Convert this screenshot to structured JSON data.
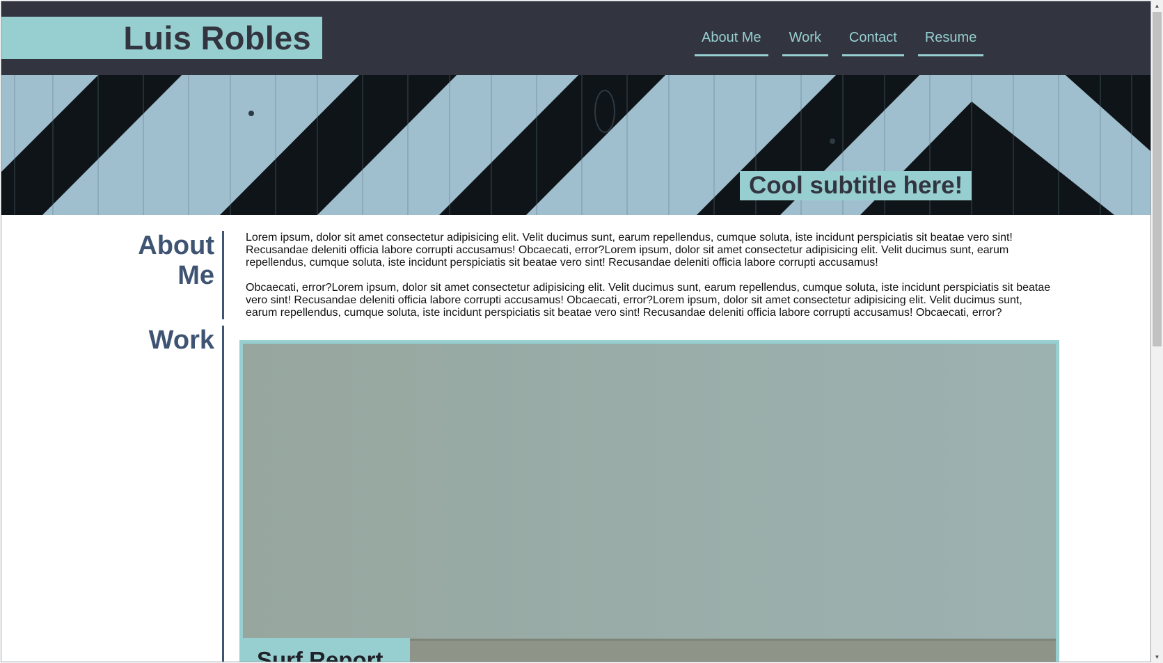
{
  "header": {
    "brand": "Luis Robles",
    "nav": [
      "About Me",
      "Work",
      "Contact",
      "Resume"
    ]
  },
  "hero": {
    "subtitle": "Cool subtitle here!"
  },
  "about": {
    "title": "About Me",
    "paragraphs": [
      "Lorem ipsum, dolor sit amet consectetur adipisicing elit. Velit ducimus sunt, earum repellendus, cumque soluta, iste incidunt perspiciatis sit beatae vero sint! Recusandae deleniti officia labore corrupti accusamus! Obcaecati, error?Lorem ipsum, dolor sit amet consectetur adipisicing elit. Velit ducimus sunt, earum repellendus, cumque soluta, iste incidunt perspiciatis sit beatae vero sint! Recusandae deleniti officia labore corrupti accusamus!",
      "Obcaecati, error?Lorem ipsum, dolor sit amet consectetur adipisicing elit. Velit ducimus sunt, earum repellendus, cumque soluta, iste incidunt perspiciatis sit beatae vero sint! Recusandae deleniti officia labore corrupti accusamus! Obcaecati, error?Lorem ipsum, dolor sit amet consectetur adipisicing elit. Velit ducimus sunt, earum repellendus, cumque soluta, iste incidunt perspiciatis sit beatae vero sint! Recusandae deleniti officia labore corrupti accusamus! Obcaecati, error?"
    ]
  },
  "work": {
    "title": "Work",
    "projects": [
      {
        "title": "Surf Report"
      }
    ]
  },
  "colors": {
    "header_bg": "#32353f",
    "accent": "#97cfd1",
    "heading": "#3f5473",
    "hero_light": "#9fbfcf",
    "hero_dark": "#0f1418"
  },
  "icons": {
    "scroll_up": "scroll-up-arrow-icon",
    "scroll_down": "scroll-down-arrow-icon"
  }
}
